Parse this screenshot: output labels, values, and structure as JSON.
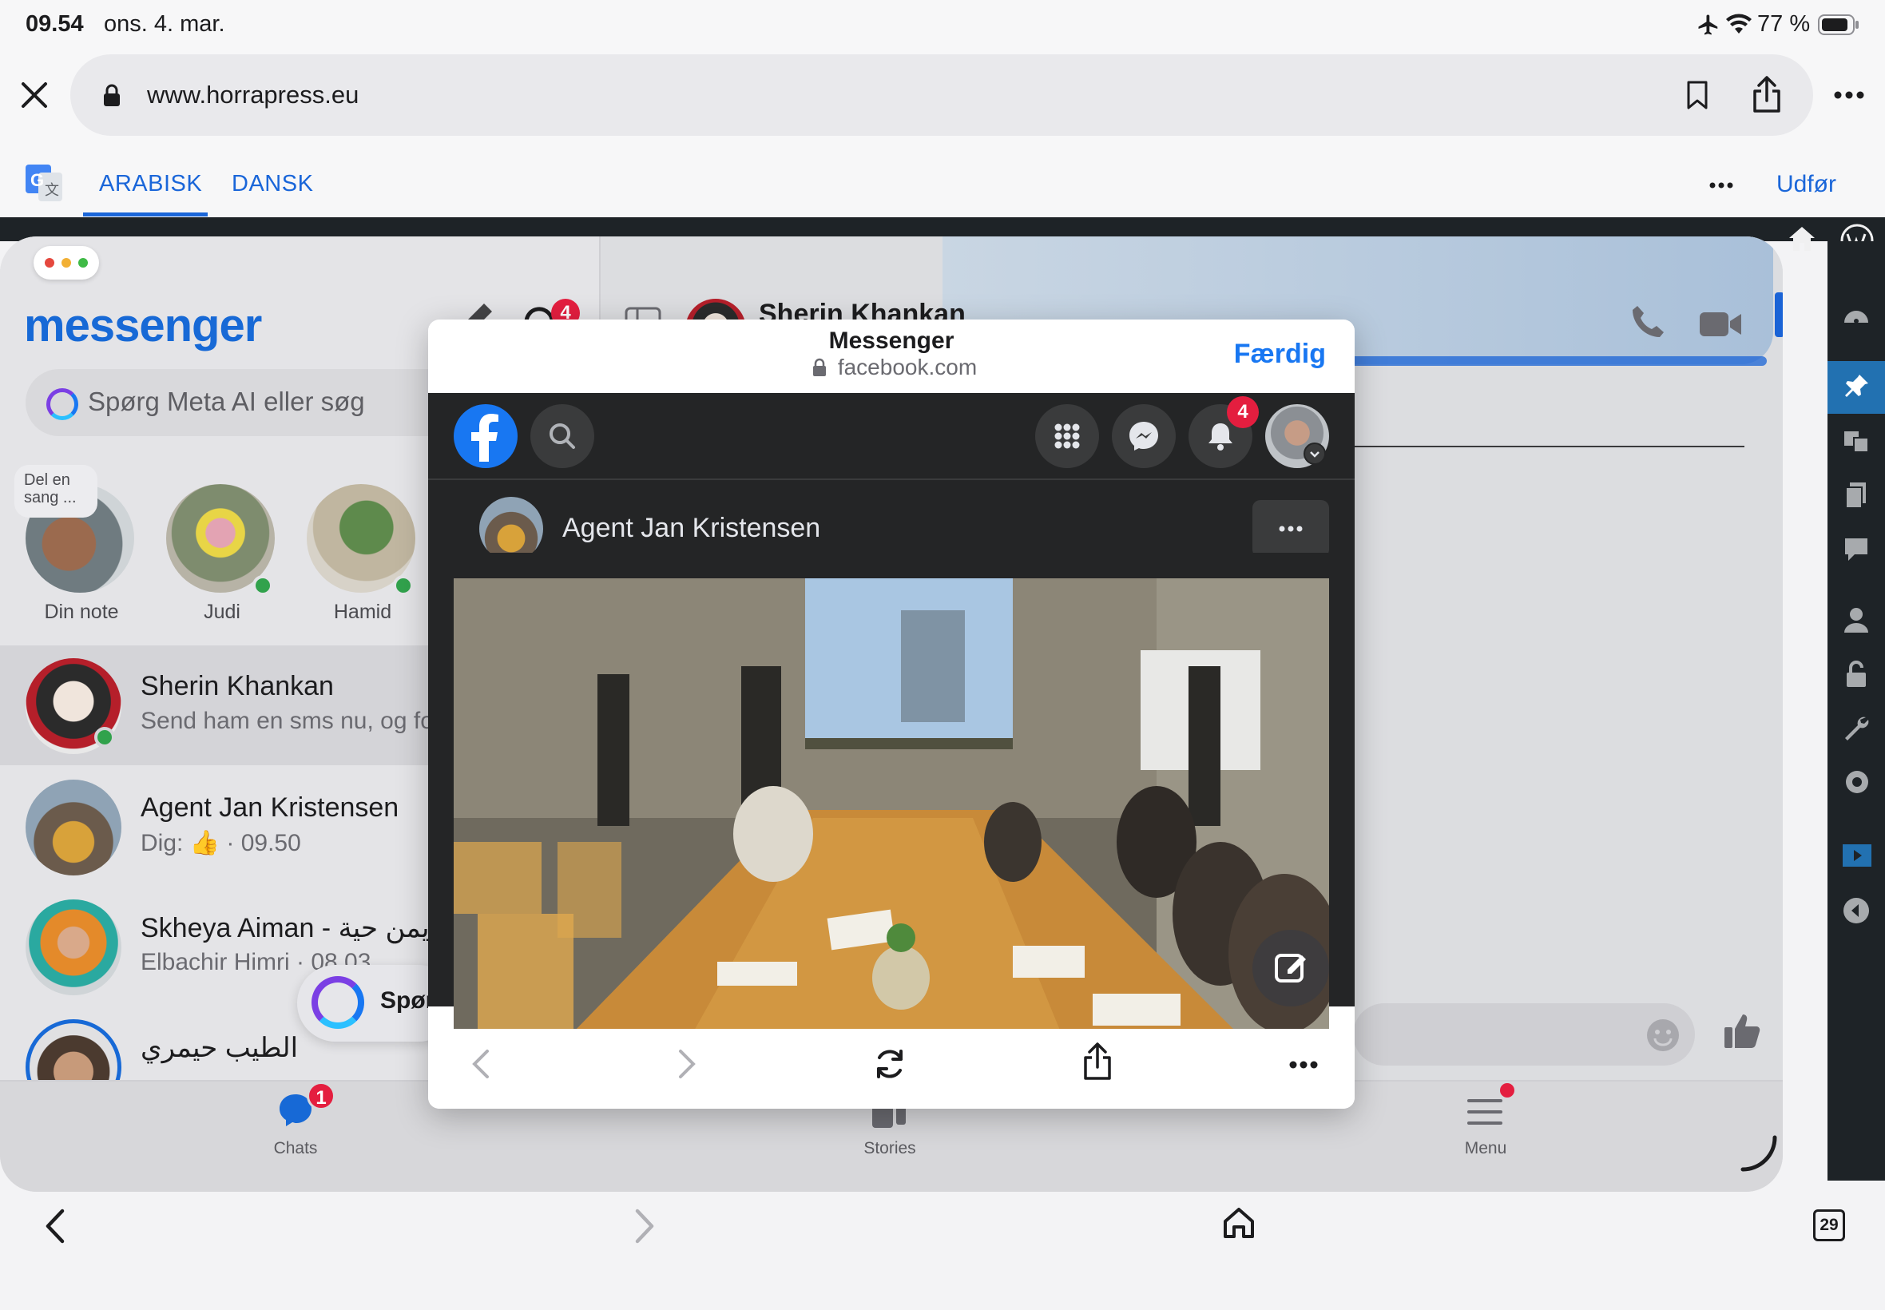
{
  "status_bar": {
    "time": "09.54",
    "date": "ons. 4. mar.",
    "battery": "77 %"
  },
  "browser": {
    "url": "www.horrapress.eu"
  },
  "translate_bar": {
    "lang_from": "ARABISK",
    "lang_to": "DANSK",
    "done": "Udfør"
  },
  "messenger": {
    "logo": "messenger",
    "header_badge": "4",
    "search_placeholder": "Spørg Meta AI eller søg",
    "note_bubble": "Del en sang ...",
    "stories": [
      {
        "name": "Din note"
      },
      {
        "name": "Judi"
      },
      {
        "name": "Hamid"
      }
    ],
    "chats": [
      {
        "name": "Sherin Khankan",
        "preview": "Send ham en sms nu, og fo"
      },
      {
        "name": "Agent Jan Kristensen",
        "preview_prefix": "Dig:",
        "preview_time": "· 09.50"
      },
      {
        "name": "Skheya Aiman - أيمن حية",
        "preview": "Elbachir Himri · 08.03"
      },
      {
        "name": "الطيب حيمري",
        "preview": ""
      }
    ],
    "meta_ai_pill": "Spør",
    "chat_header_name": "Sherin Khankan",
    "bottom_nav": {
      "chats": "Chats",
      "chats_badge": "1",
      "stories": "Stories",
      "menu": "Menu"
    }
  },
  "sheet": {
    "title": "Messenger",
    "domain": "facebook.com",
    "done": "Færdig",
    "notification_badge": "4",
    "post_author": "Agent Jan Kristensen"
  },
  "bottom_toolbar": {
    "tabs_count": "29"
  },
  "colors": {
    "messenger_blue": "#1769d6",
    "facebook_blue": "#1877f2",
    "badge_red": "#e41e3f",
    "online_green": "#31a24c",
    "safari_blue": "#1a66d9"
  }
}
